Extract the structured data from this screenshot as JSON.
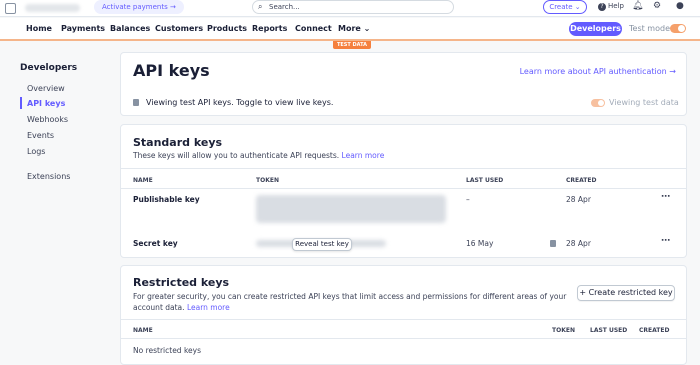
{
  "topbar": {
    "activate_label": "Activate payments →",
    "search_placeholder": "Search...",
    "create_label": "Create ⌄",
    "help_label": "Help",
    "icons": [
      "bell-icon",
      "gear-icon",
      "user-icon"
    ]
  },
  "nav": {
    "items": [
      "Home",
      "Payments",
      "Balances",
      "Customers",
      "Products",
      "Reports",
      "Connect",
      "More ⌄"
    ],
    "developers_label": "Developers",
    "test_mode_label": "Test mode",
    "test_data_badge": "TEST DATA",
    "accent_color": "#635bff",
    "test_color": "#f5803e"
  },
  "sidebar": {
    "title": "Developers",
    "items": [
      "Overview",
      "API keys",
      "Webhooks",
      "Events",
      "Logs",
      "Extensions"
    ],
    "active": "API keys"
  },
  "header_card": {
    "title": "API keys",
    "learn_link": "Learn more about API authentication →",
    "info_text": "Viewing test API keys. Toggle to view live keys.",
    "toggle_label": "Viewing test data"
  },
  "standard_keys": {
    "title": "Standard keys",
    "subtitle": "These keys will allow you to authenticate API requests.",
    "learn_more": "Learn more",
    "columns": [
      "NAME",
      "TOKEN",
      "LAST USED",
      "CREATED"
    ],
    "rows": [
      {
        "name": "Publishable key",
        "last_used": "–",
        "created": "28 Apr"
      },
      {
        "name": "Secret key",
        "last_used": "16 May",
        "created": "28 Apr"
      }
    ],
    "reveal_label": "Reveal test key",
    "more_icon": "⋯"
  },
  "restricted_keys": {
    "title": "Restricted keys",
    "subtitle": "For greater security, you can create restricted API keys that limit access and permissions for different areas of your account data.",
    "learn_more": "Learn more",
    "create_button": "+ Create restricted key",
    "columns": [
      "NAME",
      "TOKEN",
      "LAST USED",
      "CREATED"
    ],
    "empty_text": "No restricted keys"
  }
}
